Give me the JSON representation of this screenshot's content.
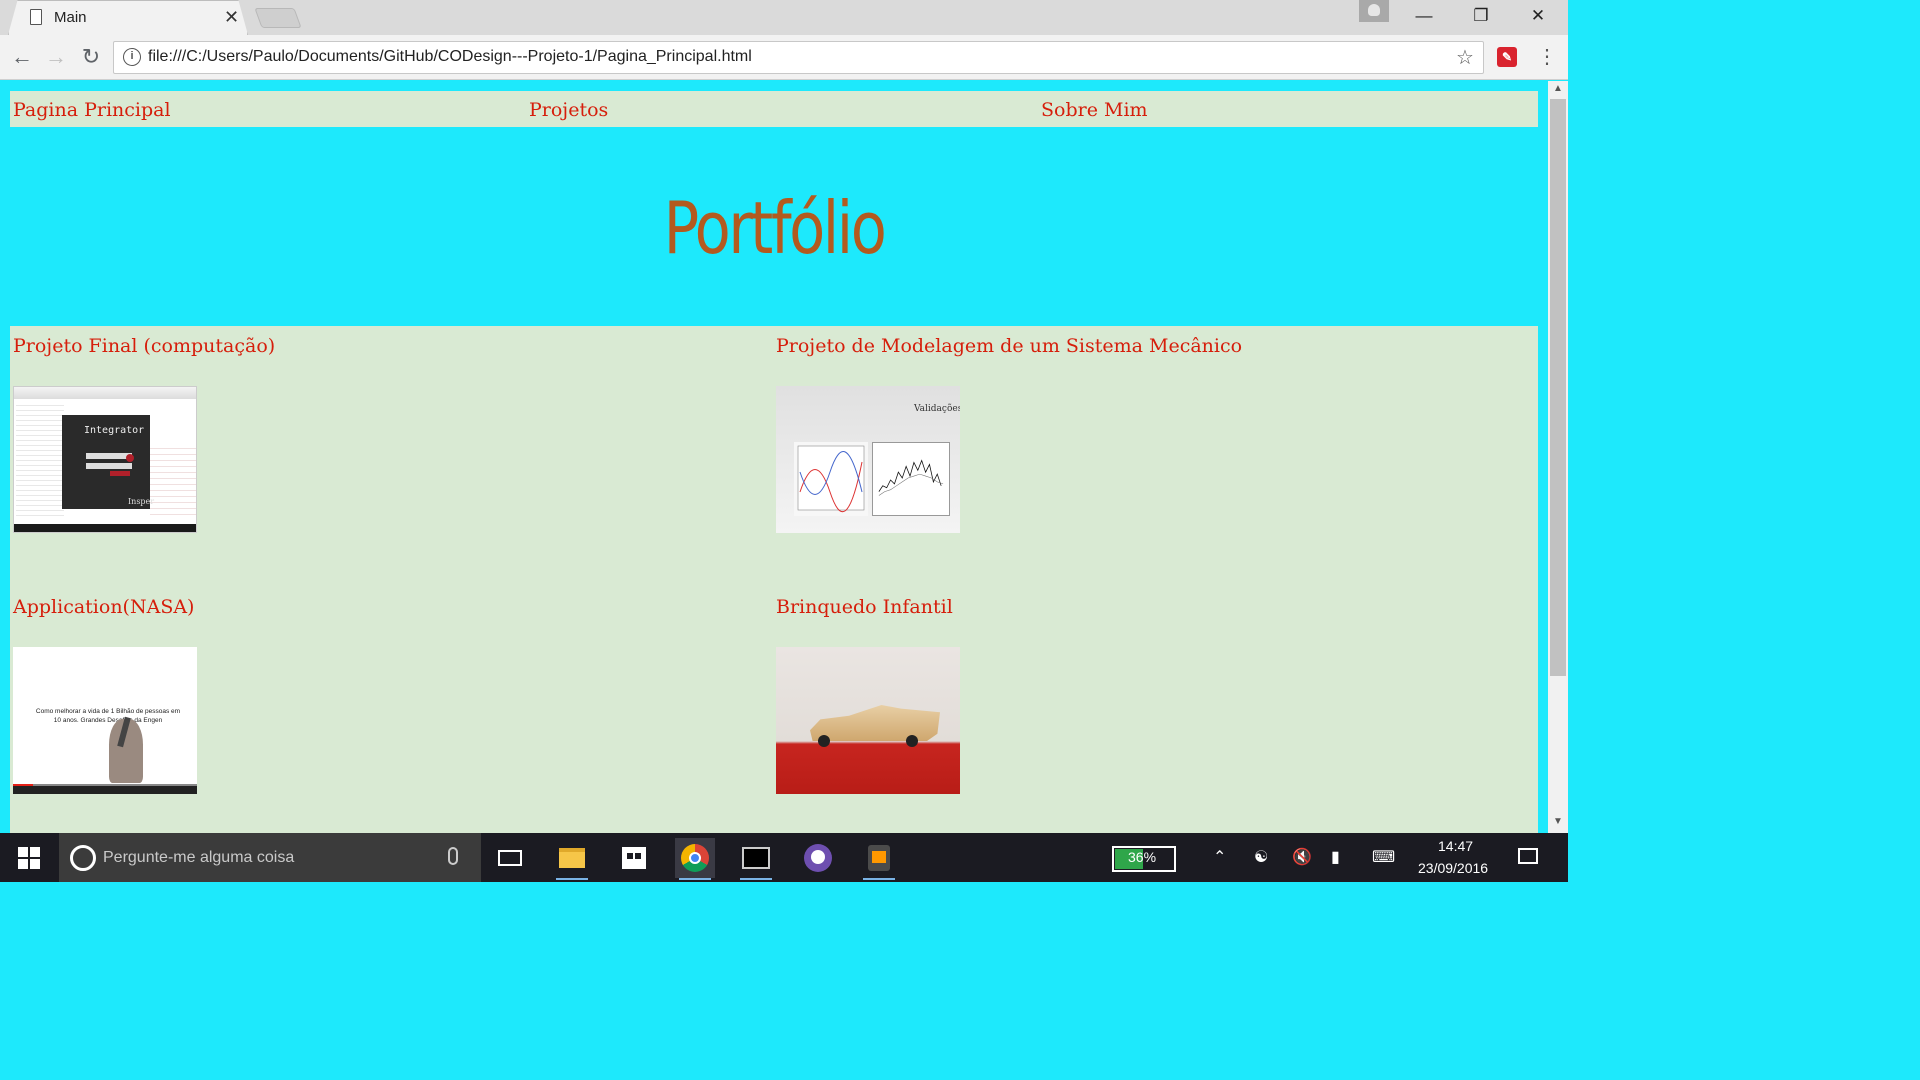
{
  "browser": {
    "tab": {
      "title": "Main",
      "close": "✕"
    },
    "url": "file:///C:/Users/Paulo/Documents/GitHub/CODesign---Projeto-1/Pagina_Principal.html",
    "icons": [
      "file-icon",
      "back-icon",
      "forward-icon",
      "reload-icon",
      "info-icon",
      "star-icon",
      "extension-icon",
      "menu-icon"
    ]
  },
  "page": {
    "nav": [
      "Pagina Principal",
      "Projetos",
      "Sobre Mim"
    ],
    "hero_title": "Portfólio",
    "projects": [
      {
        "title": "Projeto Final (computação)",
        "thumb": {
          "app_name": "Integrator",
          "brand": "Insper"
        }
      },
      {
        "title": "Projeto de Modelagem de um Sistema Mecânico",
        "thumb": {
          "label": "Validações:"
        }
      },
      {
        "title": "Application(NASA)",
        "thumb": {
          "caption": "Como melhorar a vida de 1 Bilhão de pessoas em 10 anos. Grandes Desafios da Engen"
        }
      },
      {
        "title": "Brinquedo Infantil"
      }
    ],
    "colors": {
      "background": "#1de9fc",
      "panel": "#d9ead3",
      "link": "#d61e0b",
      "hero": "#b35a1f"
    }
  },
  "taskbar": {
    "search_placeholder": "Pergunte-me alguma coisa",
    "battery": "36%",
    "time": "14:47",
    "date": "23/09/2016",
    "apps": [
      "task-view",
      "file-explorer",
      "store",
      "chrome",
      "terminal",
      "github-desktop",
      "sublime-text"
    ]
  }
}
